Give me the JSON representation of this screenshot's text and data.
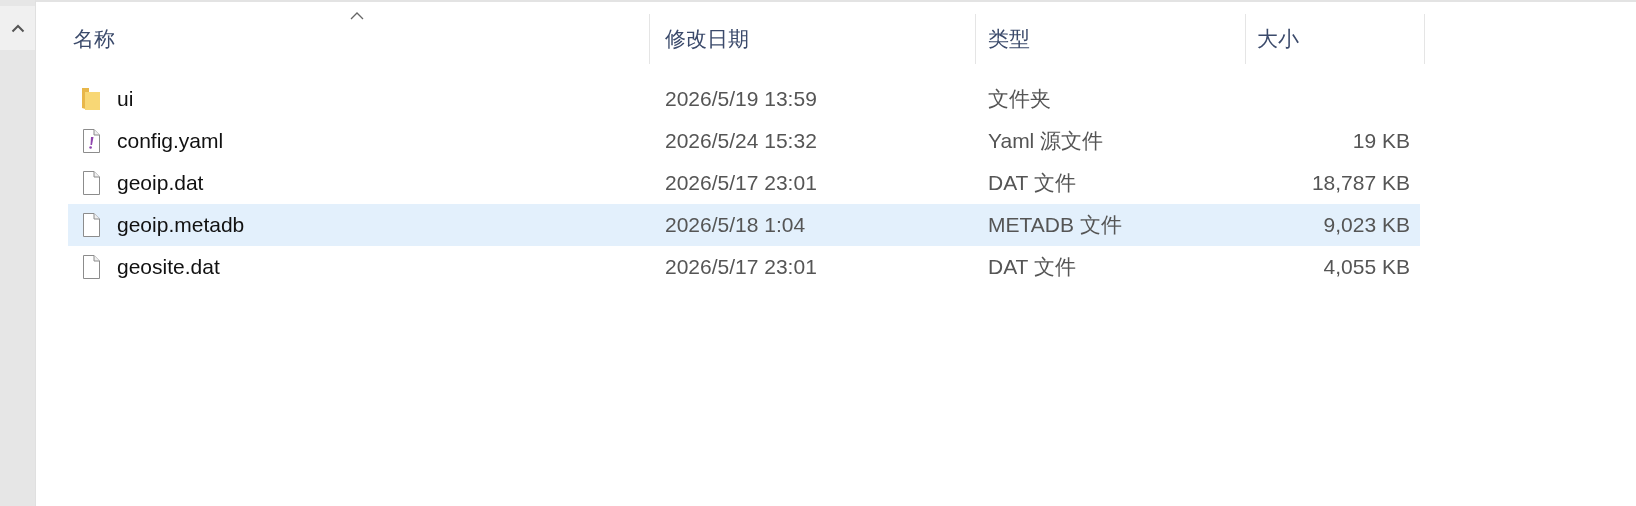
{
  "columns": [
    {
      "label": "名称",
      "sorted": true
    },
    {
      "label": "修改日期",
      "sorted": false
    },
    {
      "label": "类型",
      "sorted": false
    },
    {
      "label": "大小",
      "sorted": false
    }
  ],
  "files": [
    {
      "name": "ui",
      "kind": "folder",
      "modified": "2026/5/19 13:59",
      "type": "文件夹",
      "selected": false
    },
    {
      "name": "config.yaml",
      "kind": "yaml",
      "modified": "2026/5/24 15:32",
      "type": "Yaml 源文件",
      "size": "19 KB",
      "selected": false
    },
    {
      "name": "geoip.dat",
      "kind": "file",
      "modified": "2026/5/17 23:01",
      "type": "DAT 文件",
      "size": "18,787 KB",
      "selected": false
    },
    {
      "name": "geoip.metadb",
      "kind": "file",
      "modified": "2026/5/18 1:04",
      "type": "METADB 文件",
      "size": "9,023 KB",
      "selected": true
    },
    {
      "name": "geosite.dat",
      "kind": "file",
      "modified": "2026/5/17 23:01",
      "type": "DAT 文件",
      "size": "4,055 KB",
      "selected": false
    }
  ]
}
